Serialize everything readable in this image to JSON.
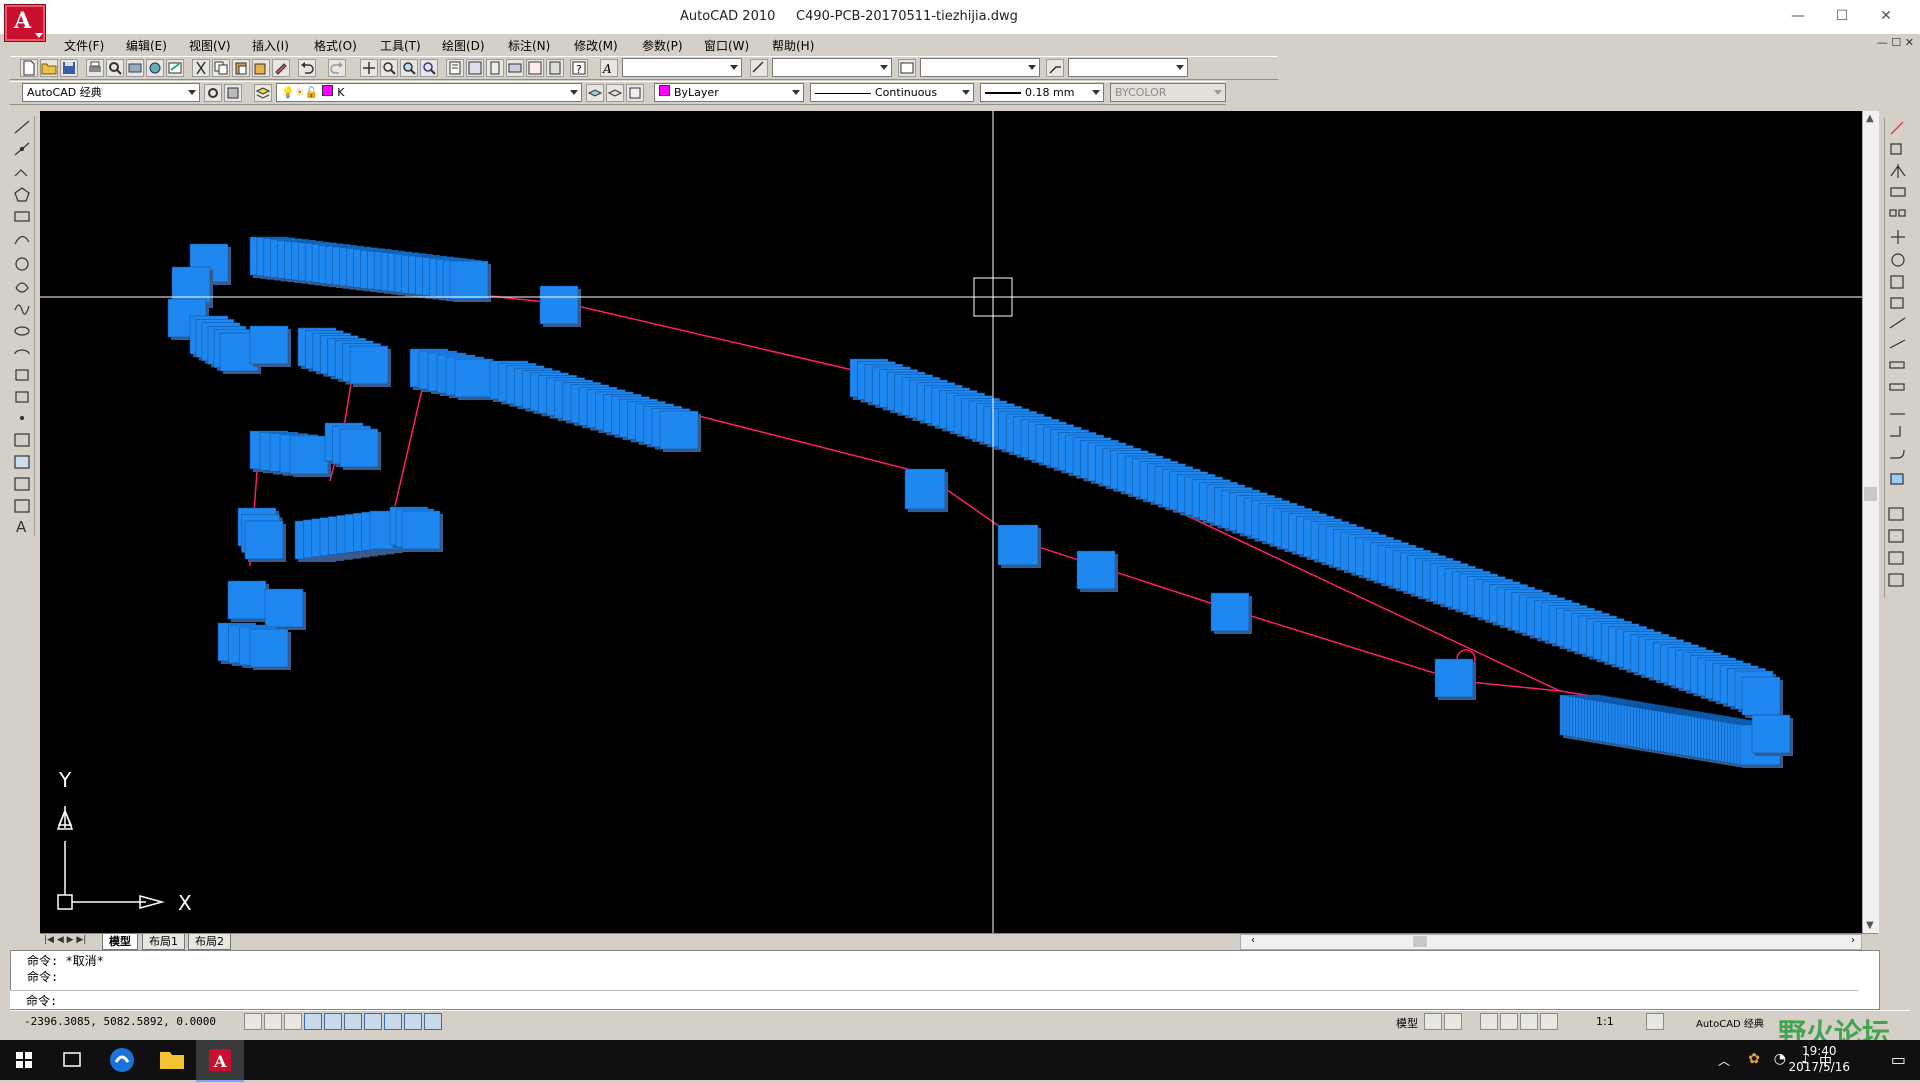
{
  "window": {
    "title": "AutoCAD 2010     C490-PCB-20170511-tiezhijia.dwg",
    "minimize": "—",
    "maximize": "☐",
    "close": "✕"
  },
  "menu": [
    "文件(F)",
    "编辑(E)",
    "视图(V)",
    "插入(I)",
    "格式(O)",
    "工具(T)",
    "绘图(D)",
    "标注(N)",
    "修改(M)",
    "参数(P)",
    "窗口(W)",
    "帮助(H)"
  ],
  "toolbar2": {
    "workspace": "AutoCAD 经典",
    "layer": "K",
    "color": "ByLayer",
    "linetype": "Continuous",
    "lineweight": "0.18 mm",
    "plotstyle": "BYCOLOR"
  },
  "colors": {
    "pad": "#1e87f0",
    "pad_shadow": "#3b5c8a",
    "trace": "#ff1d6e",
    "crosshair": "#ffffff",
    "canvas": "#000000"
  },
  "ucs": {
    "x_label": "X",
    "y_label": "Y"
  },
  "layout_tabs": [
    "模型",
    "布局1",
    "布局2"
  ],
  "command": {
    "line1": "命令: *取消*",
    "line2": "命令:",
    "prompt": "命令:"
  },
  "status": {
    "coords": "-2396.3085, 5082.5892, 0.0000",
    "model": "模型",
    "scale": "1:1",
    "workspace": "AutoCAD 经典"
  },
  "taskbar": {
    "time": "19:40",
    "date": "2017/5/16",
    "ime": "中"
  },
  "watermark": "野火论坛"
}
